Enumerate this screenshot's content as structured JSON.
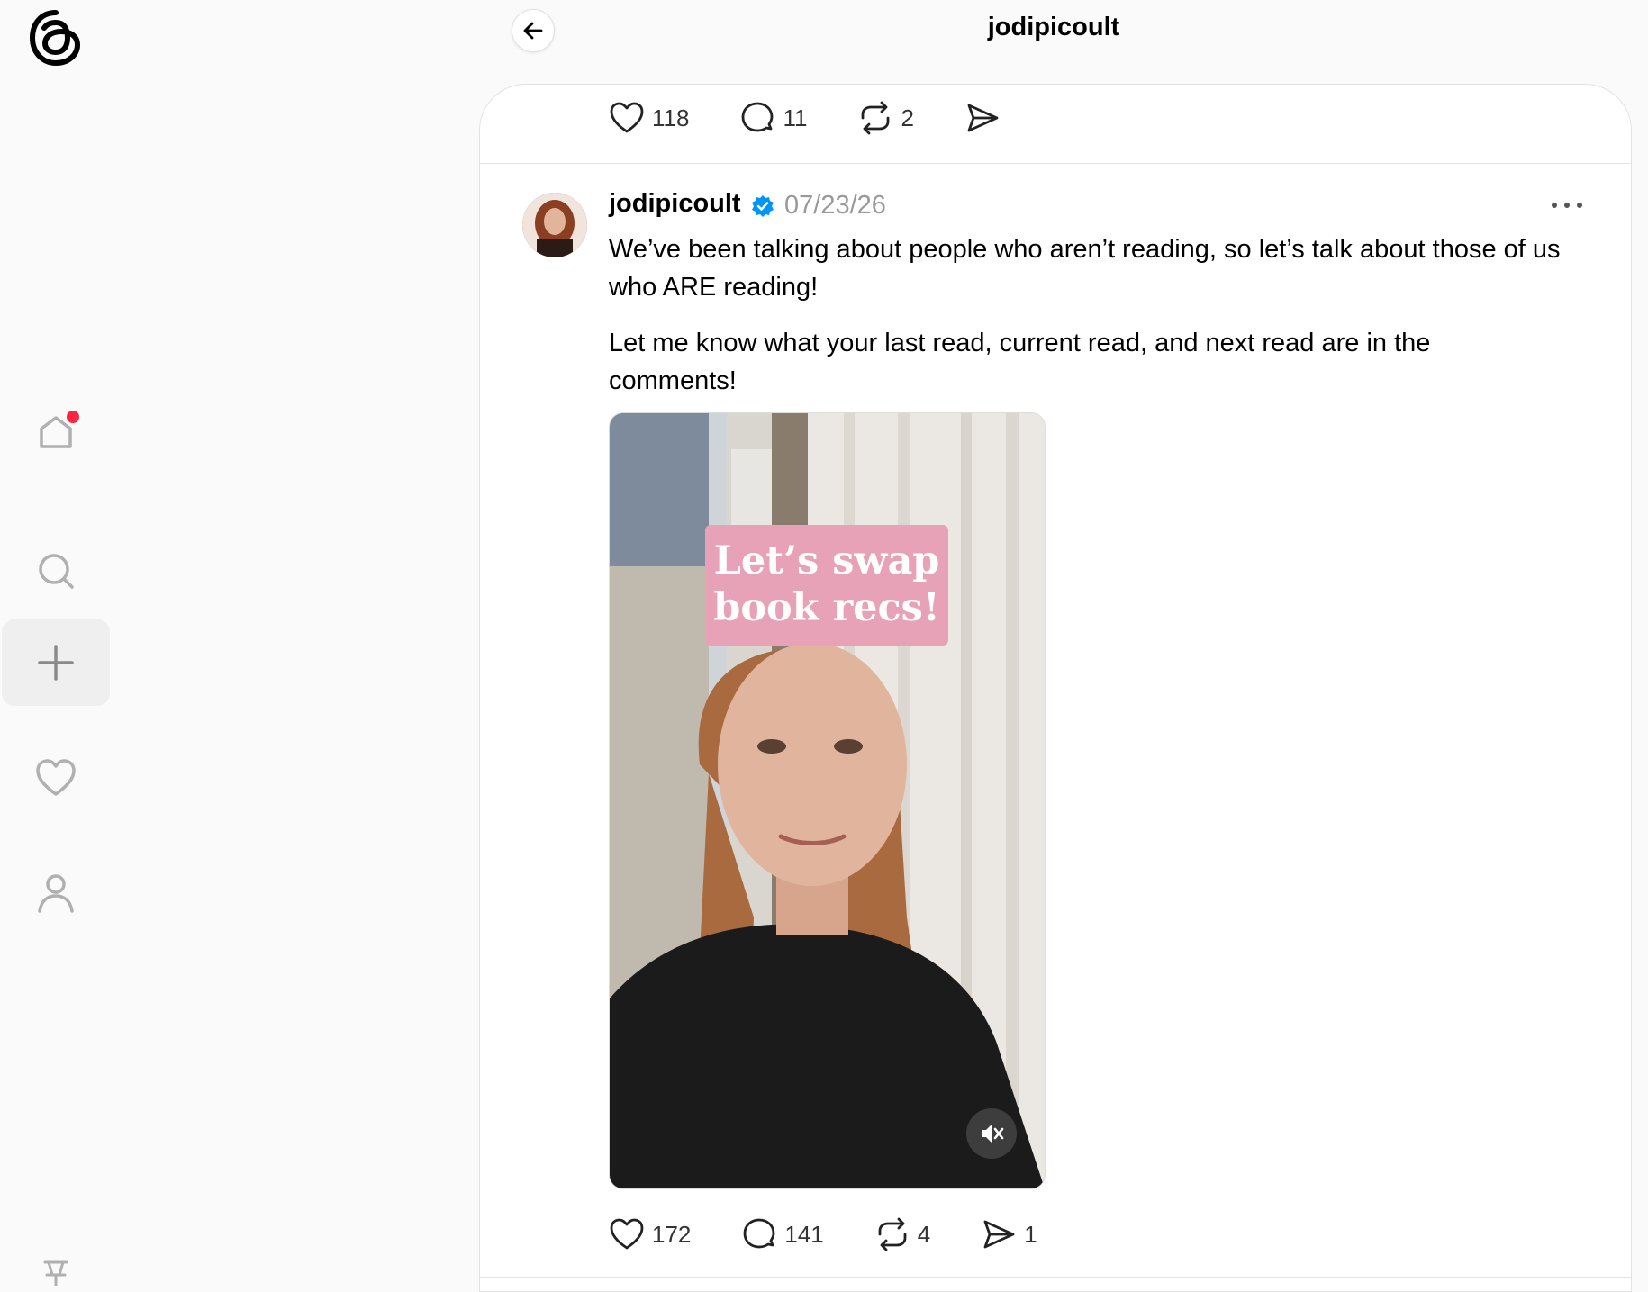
{
  "header": {
    "title": "jodipicoult"
  },
  "previous_post": {
    "likes": "118",
    "comments": "11",
    "reposts": "2"
  },
  "post": {
    "username": "jodipicoult",
    "timestamp": "07/23/26",
    "paragraphs": [
      "We’ve been talking about people who aren’t reading, so let’s talk about those of us who ARE reading!",
      "Let me know what your last read, current read, and next read are in the comments!"
    ],
    "media": {
      "overlay_line1": "Let’s swap",
      "overlay_line2": "book recs!"
    },
    "likes": "172",
    "comments": "141",
    "reposts": "4",
    "shares": "1"
  },
  "sidebar": {
    "items": [
      "home",
      "search",
      "create",
      "activity",
      "profile"
    ]
  },
  "colors": {
    "notification": "#ff2442",
    "verified": "#0095f6",
    "overlay": "#e8a2b8"
  }
}
